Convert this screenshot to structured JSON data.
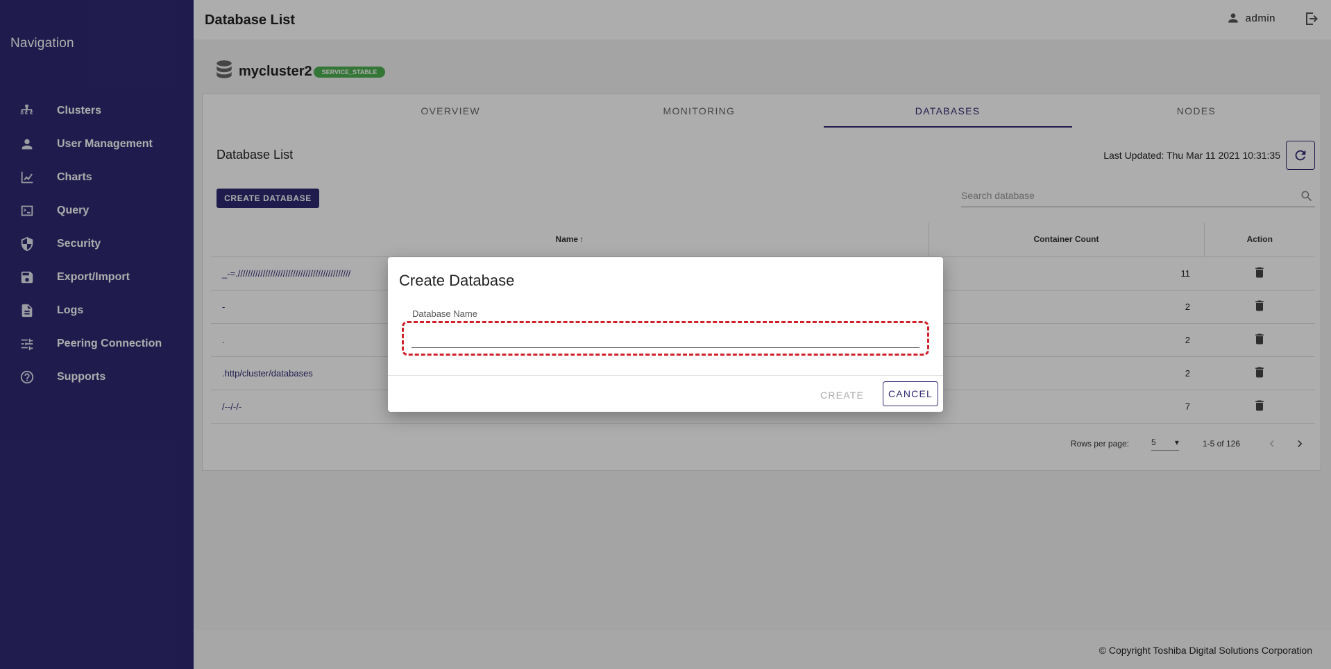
{
  "sidebar": {
    "title": "Navigation",
    "items": [
      {
        "label": "Clusters",
        "icon": "clusters-icon"
      },
      {
        "label": "User Management",
        "icon": "user-icon"
      },
      {
        "label": "Charts",
        "icon": "chart-icon"
      },
      {
        "label": "Query",
        "icon": "terminal-icon"
      },
      {
        "label": "Security",
        "icon": "shield-icon"
      },
      {
        "label": "Export/Import",
        "icon": "save-icon"
      },
      {
        "label": "Logs",
        "icon": "document-icon"
      },
      {
        "label": "Peering Connection",
        "icon": "peering-icon"
      },
      {
        "label": "Supports",
        "icon": "help-icon"
      }
    ]
  },
  "header": {
    "title": "Database List",
    "username": "admin"
  },
  "cluster": {
    "name": "mycluster2",
    "status": "SERVICE_STABLE"
  },
  "tabs": [
    {
      "label": "OVERVIEW",
      "active": false
    },
    {
      "label": "MONITORING",
      "active": false
    },
    {
      "label": "DATABASES",
      "active": true
    },
    {
      "label": "NODES",
      "active": false
    }
  ],
  "database_list": {
    "title": "Database List",
    "last_updated": "Last Updated: Thu Mar 11 2021 10:31:35",
    "create_button": "CREATE DATABASE",
    "search_placeholder": "Search database",
    "columns": {
      "name": "Name",
      "count": "Container Count",
      "action": "Action"
    },
    "rows": [
      {
        "name": "_-=./////////////////////////////////////////////",
        "count": "11"
      },
      {
        "name": "-",
        "count": "2"
      },
      {
        "name": ".",
        "count": "2"
      },
      {
        "name": ".http/cluster/databases",
        "count": "2"
      },
      {
        "name": "/--/-/-",
        "count": "7"
      }
    ],
    "pagination": {
      "rows_per_page_label": "Rows per page:",
      "rows_per_page": "5",
      "range": "1-5 of 126"
    }
  },
  "footer": {
    "copyright": "© Copyright Toshiba Digital Solutions Corporation"
  },
  "dialog": {
    "title": "Create Database",
    "field_label": "Database Name",
    "field_value": "",
    "create_label": "CREATE",
    "cancel_label": "CANCEL"
  },
  "colors": {
    "primary": "#2f2a72",
    "badge": "#4caf50",
    "highlight": "#d0202a"
  }
}
